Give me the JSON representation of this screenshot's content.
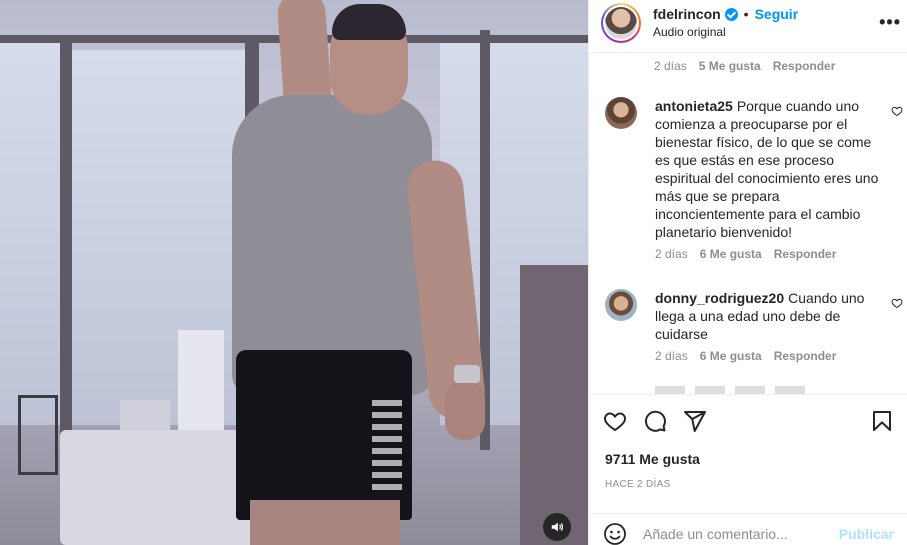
{
  "post": {
    "username": "fdelrincon",
    "separator": "•",
    "follow_label": "Seguir",
    "audio": "Audio original",
    "more_label": "•••"
  },
  "first_meta": {
    "time": "2 días",
    "likes": "5 Me gusta",
    "reply": "Responder"
  },
  "comments": [
    {
      "user": "antonieta25",
      "text": "Porque cuando uno comienza a preocuparse por el bienestar físico, de lo que se come es que estás en ese proceso espiritual del conocimiento eres uno más que se prepara inconcientemente para el cambio planetario bienvenido!",
      "time": "2 días",
      "likes": "6 Me gusta",
      "reply": "Responder"
    },
    {
      "user": "donny_rodriguez20",
      "text": "Cuando uno llega a una edad uno debe de cuidarse",
      "time": "2 días",
      "likes": "6 Me gusta",
      "reply": "Responder"
    }
  ],
  "stats": {
    "likes": "9711 Me gusta",
    "date": "HACE 2 DÍAS"
  },
  "add_comment": {
    "placeholder": "Añade un comentario...",
    "publish": "Publicar"
  },
  "icons": {
    "like": "heart-icon",
    "comment": "comment-icon",
    "share": "share-icon",
    "save": "bookmark-icon",
    "emoji": "emoji-icon",
    "sound": "speaker-icon",
    "verified": "verified-badge-icon",
    "more": "more-options-icon"
  },
  "colors": {
    "link": "#0095f6",
    "publish_disabled": "#b2dffc",
    "muted": "#8e8e8e"
  }
}
